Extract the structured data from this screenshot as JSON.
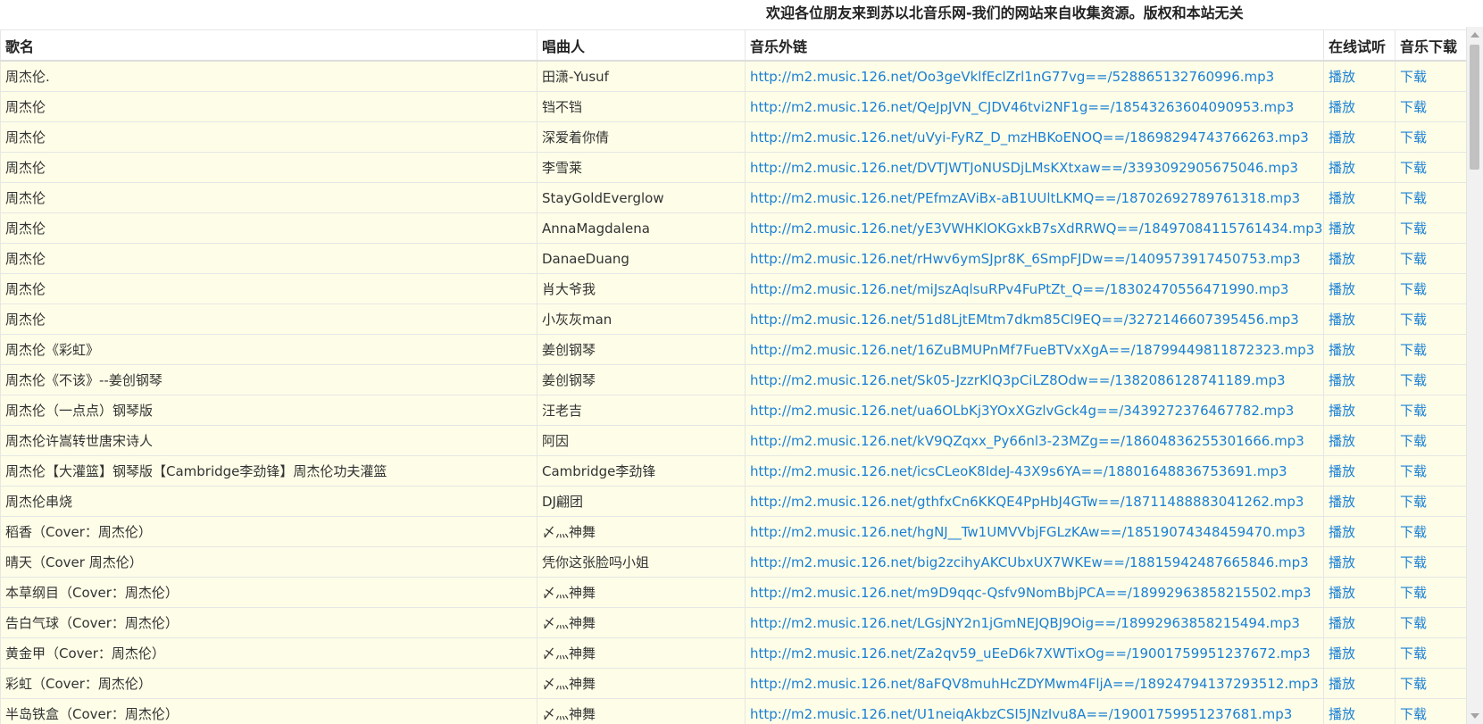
{
  "banner": {
    "text": "欢迎各位朋友来到苏以北音乐网-我们的网站来自收集资源。版权和本站无关"
  },
  "table": {
    "headers": {
      "song": "歌名",
      "singer": "唱曲人",
      "link": "音乐外链",
      "play": "在线试听",
      "download": "音乐下载"
    },
    "rows": [
      {
        "song": "周杰伦.",
        "singer": "田潇-Yusuf",
        "link": "http://m2.music.126.net/Oo3geVklfEclZrl1nG77vg==/528865132760996.mp3",
        "play": "播放",
        "download": "下载"
      },
      {
        "song": "周杰伦",
        "singer": "铛不铛",
        "link": "http://m2.music.126.net/QeJpJVN_CJDV46tvi2NF1g==/18543263604090953.mp3",
        "play": "播放",
        "download": "下载"
      },
      {
        "song": "周杰伦",
        "singer": "深爱着你倩",
        "link": "http://m2.music.126.net/uVyi-FyRZ_D_mzHBKoENOQ==/18698294743766263.mp3",
        "play": "播放",
        "download": "下载"
      },
      {
        "song": "周杰伦",
        "singer": "李雪莱",
        "link": "http://m2.music.126.net/DVTJWTJoNUSDjLMsKXtxaw==/3393092905675046.mp3",
        "play": "播放",
        "download": "下载"
      },
      {
        "song": "周杰伦",
        "singer": "StayGoldEverglow",
        "link": "http://m2.music.126.net/PEfmzAViBx-aB1UUltLKMQ==/18702692789761318.mp3",
        "play": "播放",
        "download": "下载"
      },
      {
        "song": "周杰伦",
        "singer": "AnnaMagdalena",
        "link": "http://m2.music.126.net/yE3VWHKlOKGxkB7sXdRRWQ==/18497084115761434.mp3",
        "play": "播放",
        "download": "下载"
      },
      {
        "song": "周杰伦",
        "singer": "DanaeDuang",
        "link": "http://m2.music.126.net/rHwv6ymSJpr8K_6SmpFJDw==/1409573917450753.mp3",
        "play": "播放",
        "download": "下载"
      },
      {
        "song": "周杰伦",
        "singer": "肖大爷我",
        "link": "http://m2.music.126.net/miJszAqlsuRPv4FuPtZt_Q==/18302470556471990.mp3",
        "play": "播放",
        "download": "下载"
      },
      {
        "song": "周杰伦",
        "singer": "小灰灰man",
        "link": "http://m2.music.126.net/51d8LjtEMtm7dkm85Cl9EQ==/3272146607395456.mp3",
        "play": "播放",
        "download": "下载"
      },
      {
        "song": "周杰伦《彩虹》",
        "singer": "姜创钢琴",
        "link": "http://m2.music.126.net/16ZuBMUPnMf7FueBTVxXgA==/18799449811872323.mp3",
        "play": "播放",
        "download": "下载"
      },
      {
        "song": "周杰伦《不该》--姜创钢琴",
        "singer": "姜创钢琴",
        "link": "http://m2.music.126.net/Sk05-JzzrKlQ3pCiLZ8Odw==/1382086128741189.mp3",
        "play": "播放",
        "download": "下载"
      },
      {
        "song": "周杰伦（一点点）钢琴版",
        "singer": "汪老吉",
        "link": "http://m2.music.126.net/ua6OLbKj3YOxXGzlvGck4g==/3439272376467782.mp3",
        "play": "播放",
        "download": "下载"
      },
      {
        "song": "周杰伦许嵩转世唐宋诗人",
        "singer": "阿因",
        "link": "http://m2.music.126.net/kV9QZqxx_Py66nl3-23MZg==/18604836255301666.mp3",
        "play": "播放",
        "download": "下载"
      },
      {
        "song": "周杰伦【大灌篮】钢琴版【Cambridge李劲锋】周杰伦功夫灌篮",
        "singer": "Cambridge李劲锋",
        "link": "http://m2.music.126.net/icsCLeoK8IdeJ-43X9s6YA==/18801648836753691.mp3",
        "play": "播放",
        "download": "下载"
      },
      {
        "song": "周杰伦串烧",
        "singer": "DJ翩团",
        "link": "http://m2.music.126.net/gthfxCn6KKQE4PpHbJ4GTw==/18711488883041262.mp3",
        "play": "播放",
        "download": "下载"
      },
      {
        "song": "稻香（Cover：周杰伦）",
        "singer": "〆灬神舞",
        "link": "http://m2.music.126.net/hgNJ__Tw1UMVVbjFGLzKAw==/18519074348459470.mp3",
        "play": "播放",
        "download": "下载"
      },
      {
        "song": "晴天（Cover 周杰伦）",
        "singer": "凭你这张脸吗小姐",
        "link": "http://m2.music.126.net/big2zcihyAKCUbxUX7WKEw==/18815942487665846.mp3",
        "play": "播放",
        "download": "下载"
      },
      {
        "song": "本草纲目（Cover：周杰伦）",
        "singer": "〆灬神舞",
        "link": "http://m2.music.126.net/m9D9qqc-Qsfv9NomBbjPCA==/18992963858215502.mp3",
        "play": "播放",
        "download": "下载"
      },
      {
        "song": "告白气球（Cover：周杰伦）",
        "singer": "〆灬神舞",
        "link": "http://m2.music.126.net/LGsjNY2n1jGmNEJQBJ9Oig==/18992963858215494.mp3",
        "play": "播放",
        "download": "下载"
      },
      {
        "song": "黄金甲（Cover：周杰伦）",
        "singer": "〆灬神舞",
        "link": "http://m2.music.126.net/Za2qv59_uEeD6k7XWTixOg==/19001759951237672.mp3",
        "play": "播放",
        "download": "下载"
      },
      {
        "song": "彩虹（Cover：周杰伦）",
        "singer": "〆灬神舞",
        "link": "http://m2.music.126.net/8aFQV8muhHcZDYMwm4FljA==/18924794137293512.mp3",
        "play": "播放",
        "download": "下载"
      },
      {
        "song": "半岛铁盒（Cover：周杰伦）",
        "singer": "〆灬神舞",
        "link": "http://m2.music.126.net/U1neiqAkbzCSI5JNzIvu8A==/19001759951237681.mp3",
        "play": "播放",
        "download": "下载"
      }
    ]
  }
}
